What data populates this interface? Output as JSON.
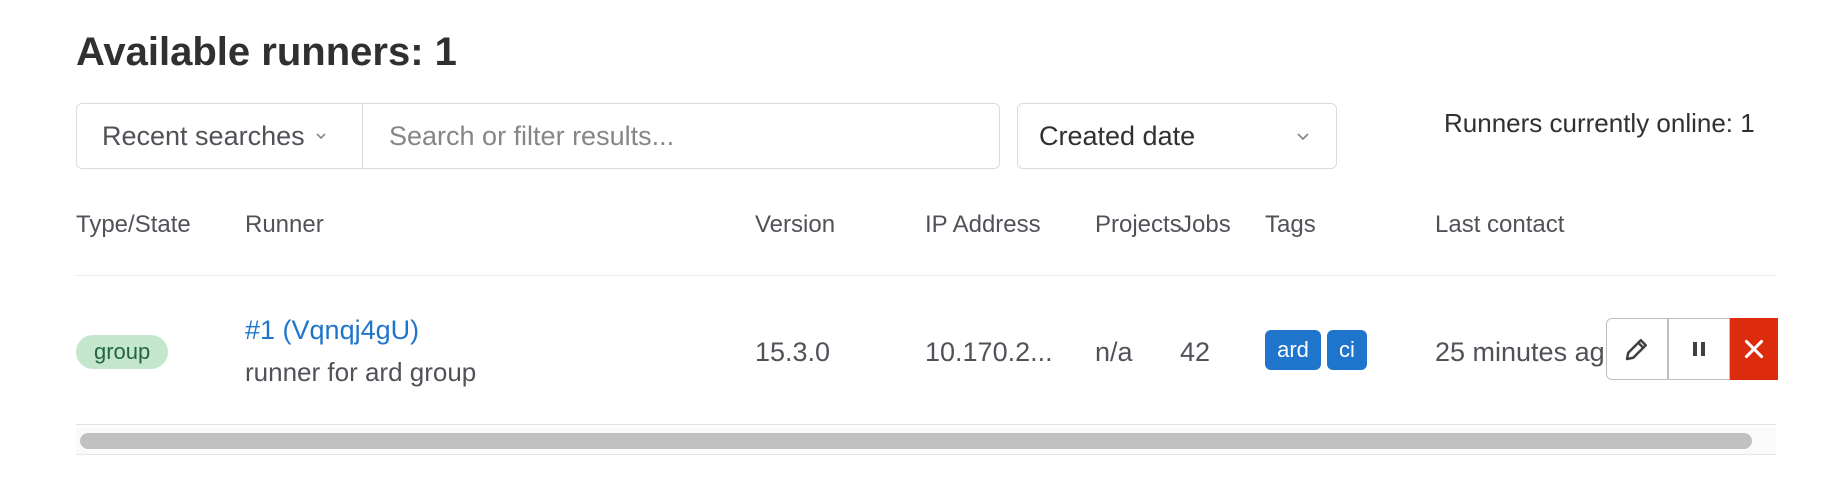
{
  "title": "Available runners: 1",
  "filter": {
    "recent_label": "Recent searches",
    "search_placeholder": "Search or filter results..."
  },
  "sort": {
    "selected": "Created date"
  },
  "online_status": "Runners currently online: 1",
  "table": {
    "columns": [
      "Type/State",
      "Runner",
      "Version",
      "IP Address",
      "Projects",
      "Jobs",
      "Tags",
      "Last contact"
    ],
    "row": {
      "type_badge": "group",
      "runner_name": "#1 (Vqnqj4gU)",
      "runner_description": "runner for ard group",
      "version": "15.3.0",
      "ip_address": "10.170.2...",
      "projects": "n/a",
      "jobs": "42",
      "tags": [
        "ard",
        "ci"
      ],
      "last_contact": "25 minutes ag"
    }
  },
  "icons": {
    "edit": "pencil-icon",
    "pause": "pause-icon",
    "delete": "close-icon"
  },
  "colors": {
    "link": "#1f75cb",
    "tag_bg": "#1f75cb",
    "badge_bg": "#c3e6cd",
    "danger": "#dd2b0e"
  }
}
